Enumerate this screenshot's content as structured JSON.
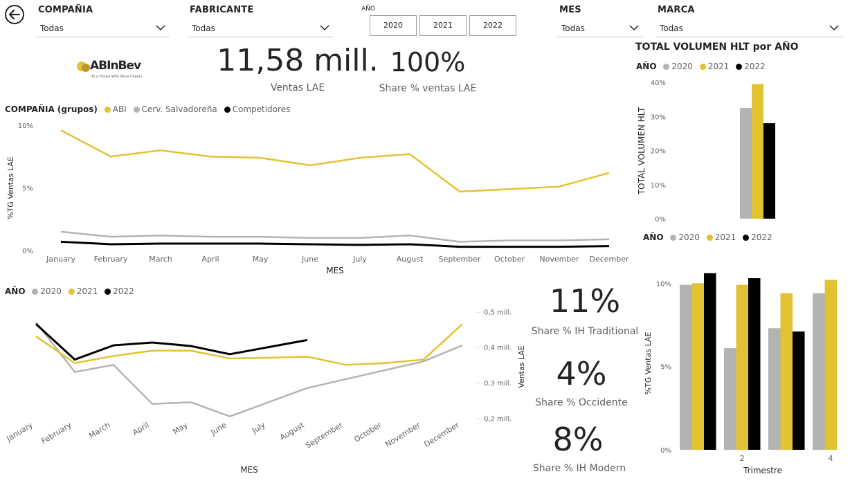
{
  "colors": {
    "y2020": "#b3b3b3",
    "y2021": "#e1c233",
    "y2022": "#000000",
    "abi": "#e1c233",
    "cerv": "#b3b3b3",
    "comp": "#000000"
  },
  "nav": {
    "back_icon": "back-arrow-icon"
  },
  "slicers": {
    "compania": {
      "title": "COMPAÑIA",
      "value": "Todas"
    },
    "fabricante": {
      "title": "FABRICANTE",
      "value": "Todas"
    },
    "anio": {
      "title": "AÑO",
      "options": [
        "2020",
        "2021",
        "2022"
      ]
    },
    "mes": {
      "title": "MES",
      "value": "Todas"
    },
    "marca": {
      "title": "MARCA",
      "value": "Todas"
    }
  },
  "logo": {
    "name": "ABInBev",
    "tagline": "To a Future With More Cheers"
  },
  "kpis": {
    "ventas": {
      "value": "11,58 mill.",
      "label": "Ventas LAE"
    },
    "share": {
      "value": "100%",
      "label": "Share % ventas LAE"
    },
    "traditional": {
      "value": "11%",
      "label": "Share % IH Traditional"
    },
    "occidente": {
      "value": "4%",
      "label": "Share % Occidente"
    },
    "modern": {
      "value": "8%",
      "label": "Share % IH Modern"
    }
  },
  "chart_data": [
    {
      "id": "tg-by-company",
      "type": "line",
      "legend_title": "COMPAÑIA (grupos)",
      "xlabel": "MES",
      "ylabel": "%TG Ventas LAE",
      "ylim": [
        0,
        10
      ],
      "yticks": [
        "0%",
        "5%",
        "10%"
      ],
      "categories": [
        "January",
        "February",
        "March",
        "April",
        "May",
        "June",
        "July",
        "August",
        "September",
        "October",
        "November",
        "December"
      ],
      "series": [
        {
          "name": "ABI",
          "values": [
            9.6,
            7.5,
            8.0,
            7.5,
            7.4,
            6.8,
            7.4,
            7.7,
            4.7,
            4.9,
            5.1,
            6.2
          ]
        },
        {
          "name": "Cerv. Salvadoreña",
          "values": [
            1.5,
            1.1,
            1.2,
            1.1,
            1.1,
            1.0,
            1.0,
            1.2,
            0.7,
            0.8,
            0.8,
            0.9
          ]
        },
        {
          "name": "Competidores",
          "values": [
            0.7,
            0.5,
            0.55,
            0.55,
            0.55,
            0.5,
            0.45,
            0.5,
            0.3,
            0.3,
            0.3,
            0.35
          ]
        }
      ]
    },
    {
      "id": "ventas-by-year",
      "type": "line",
      "legend_title": "AÑO",
      "xlabel": "MES",
      "ylabel": "Ventas LAE",
      "ylim": [
        0.15,
        0.52
      ],
      "yticks": [
        "0,2 mill.",
        "0,3 mill.",
        "0,4 mill.",
        "0,5 mill."
      ],
      "ytick_values": [
        0.2,
        0.3,
        0.4,
        0.5
      ],
      "categories": [
        "January",
        "February",
        "March",
        "April",
        "May",
        "June",
        "July",
        "August",
        "September",
        "October",
        "November",
        "December"
      ],
      "series": [
        {
          "name": "2020",
          "values": [
            0.47,
            0.33,
            0.35,
            0.24,
            0.245,
            0.205,
            0.245,
            0.285,
            0.31,
            0.335,
            0.36,
            0.405
          ]
        },
        {
          "name": "2021",
          "values": [
            0.43,
            0.355,
            0.375,
            0.39,
            0.39,
            0.368,
            0.37,
            0.373,
            0.35,
            0.355,
            0.365,
            0.465
          ]
        },
        {
          "name": "2022",
          "values": [
            0.465,
            0.365,
            0.405,
            0.413,
            0.403,
            0.38,
            0.4,
            0.42
          ]
        }
      ]
    },
    {
      "id": "volumen-hlt-by-year",
      "type": "bar",
      "title": "TOTAL VOLUMEN HLT por AÑO",
      "legend_title": "AÑO",
      "ylabel": "TOTAL VOLUMEN HLT",
      "ylim": [
        0,
        40
      ],
      "yticks": [
        "0%",
        "10%",
        "20%",
        "30%",
        "40%"
      ],
      "categories": [
        "2020",
        "2021",
        "2022"
      ],
      "values": [
        32.5,
        39.5,
        28.0
      ]
    },
    {
      "id": "tg-by-quarter",
      "type": "bar",
      "legend_title": "AÑO",
      "xlabel": "Trimestre",
      "ylabel": "%TG Ventas LAE",
      "ylim": [
        0,
        10.8
      ],
      "yticks": [
        "0%",
        "5%",
        "10%"
      ],
      "categories": [
        "1",
        "2",
        "3",
        "4"
      ],
      "xticks": [
        "2",
        "4"
      ],
      "series": [
        {
          "name": "2020",
          "values": [
            9.9,
            6.1,
            7.3,
            9.4
          ]
        },
        {
          "name": "2021",
          "values": [
            10.0,
            9.9,
            9.4,
            10.2
          ]
        },
        {
          "name": "2022",
          "values": [
            10.6,
            10.3,
            7.1,
            null
          ]
        }
      ]
    }
  ]
}
